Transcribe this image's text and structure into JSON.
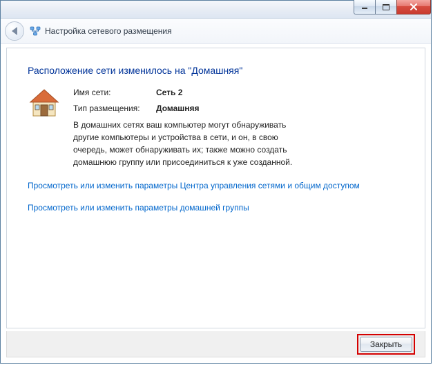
{
  "titlebar": {},
  "header": {
    "title": "Настройка сетевого размещения"
  },
  "content": {
    "heading": "Расположение сети изменилось на \"Домашняя\"",
    "network_name_label": "Имя сети:",
    "network_name_value": "Сеть  2",
    "network_type_label": "Тип размещения:",
    "network_type_value": "Домашняя",
    "description": "В домашних сетях ваш компьютер могут обнаруживать другие компьютеры и устройства в сети, и он, в свою очередь, может обнаруживать их; также можно создать домашнюю группу или присоединиться к уже созданной.",
    "link_sharing": "Просмотреть или изменить параметры Центра управления сетями и общим доступом",
    "link_homegroup": "Просмотреть или изменить параметры домашней группы"
  },
  "footer": {
    "close_label": "Закрыть"
  }
}
